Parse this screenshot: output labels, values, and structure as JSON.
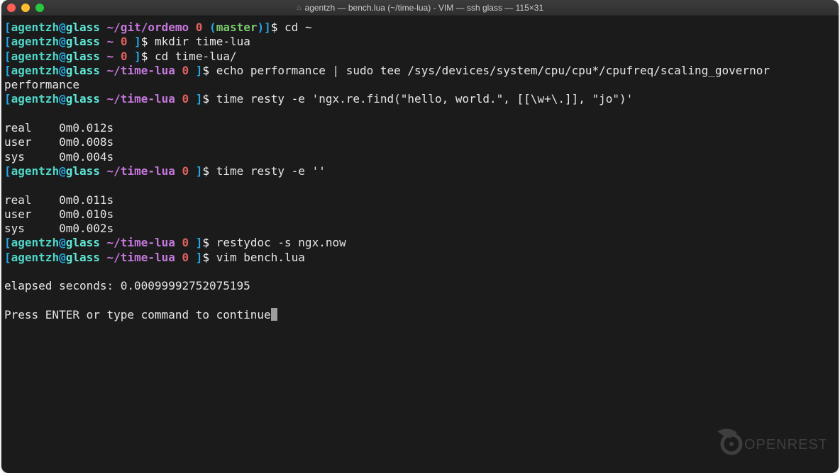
{
  "window": {
    "title": "agentzh — bench.lua (~/time-lua) - VIM — ssh glass — 115×31"
  },
  "prompt": {
    "bracket_open": "[",
    "bracket_close": "]",
    "user": "agentzh",
    "at": "@",
    "host": "glass",
    "dir_ordemo": "~/git/ordemo",
    "dir_home": "~",
    "dir_timelua": "~/time-lua",
    "status": "0",
    "branch_open": "(",
    "branch_close": ")",
    "branch": "master",
    "dollar": "$"
  },
  "commands": {
    "cd_home": "cd ~",
    "mkdir": "mkdir time-lua",
    "cd_timelua": "cd time-lua/",
    "echo_perf": "echo performance | sudo tee /sys/devices/system/cpu/cpu*/cpufreq/scaling_governor",
    "time_resty_regex": "time resty -e 'ngx.re.find(\"hello, world.\", [[\\w+\\.]], \"jo\")'",
    "time_resty_empty": "time resty -e ''",
    "restydoc": "restydoc -s ngx.now",
    "vim": "vim bench.lua"
  },
  "outputs": {
    "performance": "performance",
    "time1": {
      "real_label": "real",
      "real_value": "0m0.012s",
      "user_label": "user",
      "user_value": "0m0.008s",
      "sys_label": "sys",
      "sys_value": "0m0.004s"
    },
    "time2": {
      "real_label": "real",
      "real_value": "0m0.011s",
      "user_label": "user",
      "user_value": "0m0.010s",
      "sys_label": "sys",
      "sys_value": "0m0.002s"
    },
    "elapsed": "elapsed seconds: 0.00099992752075195",
    "press_enter": "Press ENTER or type command to continue"
  },
  "logo_text": "OPENRESTY"
}
